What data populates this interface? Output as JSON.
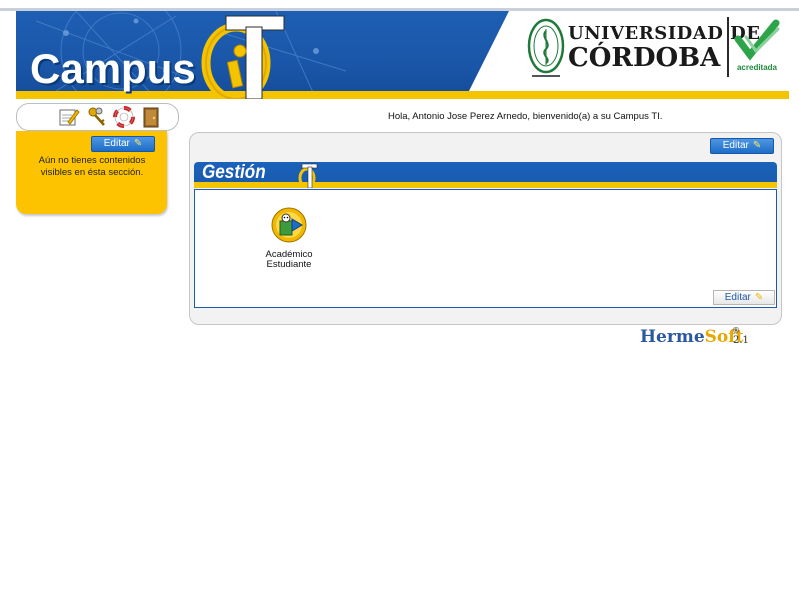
{
  "header": {
    "app_name": "Campus",
    "university_line1": "UNIVERSIDAD DE",
    "university_line2": "CÓRDOBA",
    "accreditation_label": "acreditada",
    "logo_icon": "campus-ti-logo-icon",
    "seal_icon": "university-seal-icon",
    "accreditation_icon": "accreditation-check-icon"
  },
  "toolbar": {
    "icons": [
      "edit-profile-icon",
      "keys-icon",
      "help-lifebuoy-icon",
      "logout-door-icon"
    ]
  },
  "left_panel": {
    "edit_label": "Editar",
    "empty_message": "Aún no tienes contenidos visibles en ésta sección."
  },
  "greeting": "Hola, Antonio Jose Perez Arnedo, bienvenido(a) a su Campus TI.",
  "main_panel": {
    "edit_label": "Editar",
    "section_title": "Gestión",
    "apps": [
      {
        "label_line1": "Académico",
        "label_line2": "Estudiante",
        "icon": "academic-student-icon"
      }
    ],
    "footer_edit_label": "Editar"
  },
  "footer": {
    "brand_part1": "Herme",
    "brand_part2": "Soft",
    "registered": "®",
    "version": "2.1"
  },
  "colors": {
    "brand_blue": "#1a56a8",
    "brand_yellow": "#fdc300",
    "button_blue": "#1e6cc7"
  }
}
